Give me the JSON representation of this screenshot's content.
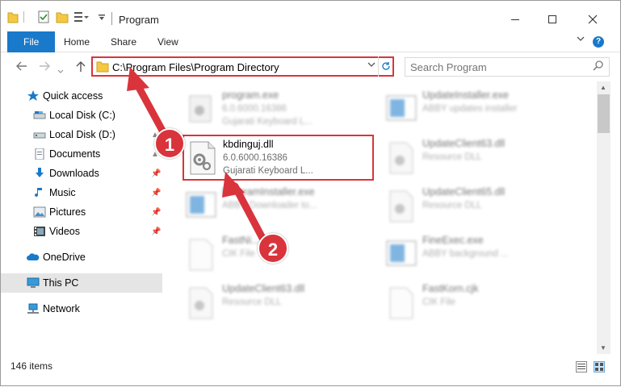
{
  "window": {
    "title": "Program",
    "minimize_icon": "minimize-icon",
    "maximize_icon": "maximize-icon",
    "close_icon": "close-icon"
  },
  "ribbon": {
    "tabs": [
      "File",
      "Home",
      "Share",
      "View"
    ],
    "help": "?"
  },
  "nav": {
    "path": "C:\\Program Files\\Program Directory",
    "search_placeholder": "Search Program"
  },
  "sidebar": {
    "items": [
      {
        "label": "Quick access",
        "icon": "star-icon"
      },
      {
        "label": "Local Disk (C:)",
        "icon": "drive-icon"
      },
      {
        "label": "Local Disk (D:)",
        "icon": "drive-icon"
      },
      {
        "label": "Documents",
        "icon": "documents-icon"
      },
      {
        "label": "Downloads",
        "icon": "download-icon"
      },
      {
        "label": "Music",
        "icon": "music-icon"
      },
      {
        "label": "Pictures",
        "icon": "pictures-icon"
      },
      {
        "label": "Videos",
        "icon": "videos-icon"
      },
      {
        "label": "OneDrive",
        "icon": "cloud-icon"
      },
      {
        "label": "This PC",
        "icon": "computer-icon"
      },
      {
        "label": "Network",
        "icon": "network-icon"
      }
    ]
  },
  "files": [
    {
      "name": "program.exe",
      "line2": "6.0.6000.16386",
      "line3": "Gujarati Keyboard L..."
    },
    {
      "name": "UpdateInstaller.exe",
      "line2": "ABBY updates installer",
      "line3": ""
    },
    {
      "name": "kbdinguj.dll",
      "line2": "6.0.6000.16386",
      "line3": "Gujarati Keyboard L..."
    },
    {
      "name": "UpdateClient63.dll",
      "line2": "Resource DLL",
      "line3": ""
    },
    {
      "name": "ProgramInstaller.exe",
      "line2": "ABBY Downloader to...",
      "line3": ""
    },
    {
      "name": "UpdateClient65.dll",
      "line2": "Resource DLL",
      "line3": ""
    },
    {
      "name": "FastNi...",
      "line2": "CIK File",
      "line3": ""
    },
    {
      "name": "FineExec.exe",
      "line2": "ABBY background ...",
      "line3": ""
    },
    {
      "name": "UpdateClient63.dll",
      "line2": "Resource DLL",
      "line3": ""
    },
    {
      "name": "FastKorn.cjk",
      "line2": "CIK File",
      "line3": ""
    }
  ],
  "status": {
    "count": "146 items"
  },
  "annotations": {
    "step1": "1",
    "step2": "2"
  },
  "colors": {
    "accent": "#1979ca",
    "highlight_red": "#d9343c",
    "selected_bg": "#cce8ff"
  }
}
